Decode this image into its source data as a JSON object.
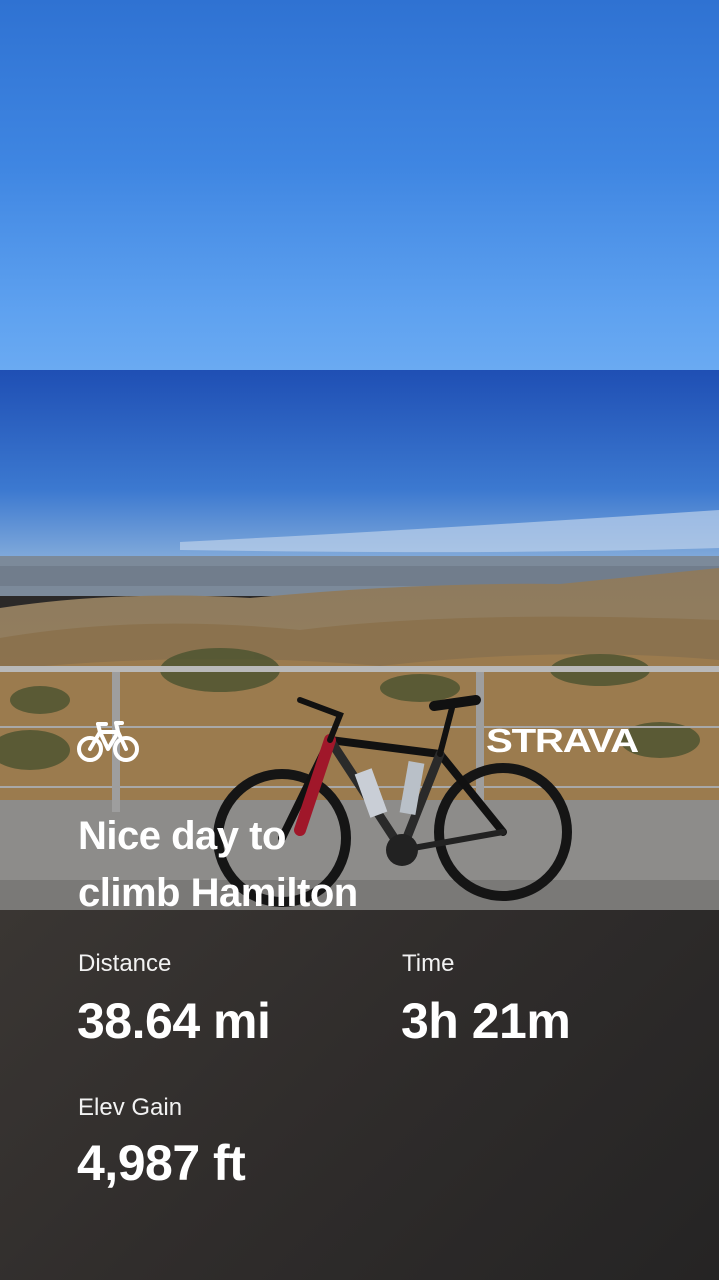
{
  "activity": {
    "type_icon": "bicycle-icon",
    "brand": "STRAVA",
    "title_line1": "Nice day to",
    "title_line2": "climb Hamilton"
  },
  "stats": {
    "distance_label": "Distance",
    "distance_value": "38.64 mi",
    "time_label": "Time",
    "time_value": "3h 21m",
    "elev_label": "Elev Gain",
    "elev_value": "4,987 ft"
  },
  "colors": {
    "sky": "#3f86e2",
    "panel": "#2f2c2b",
    "text": "#ffffff"
  }
}
